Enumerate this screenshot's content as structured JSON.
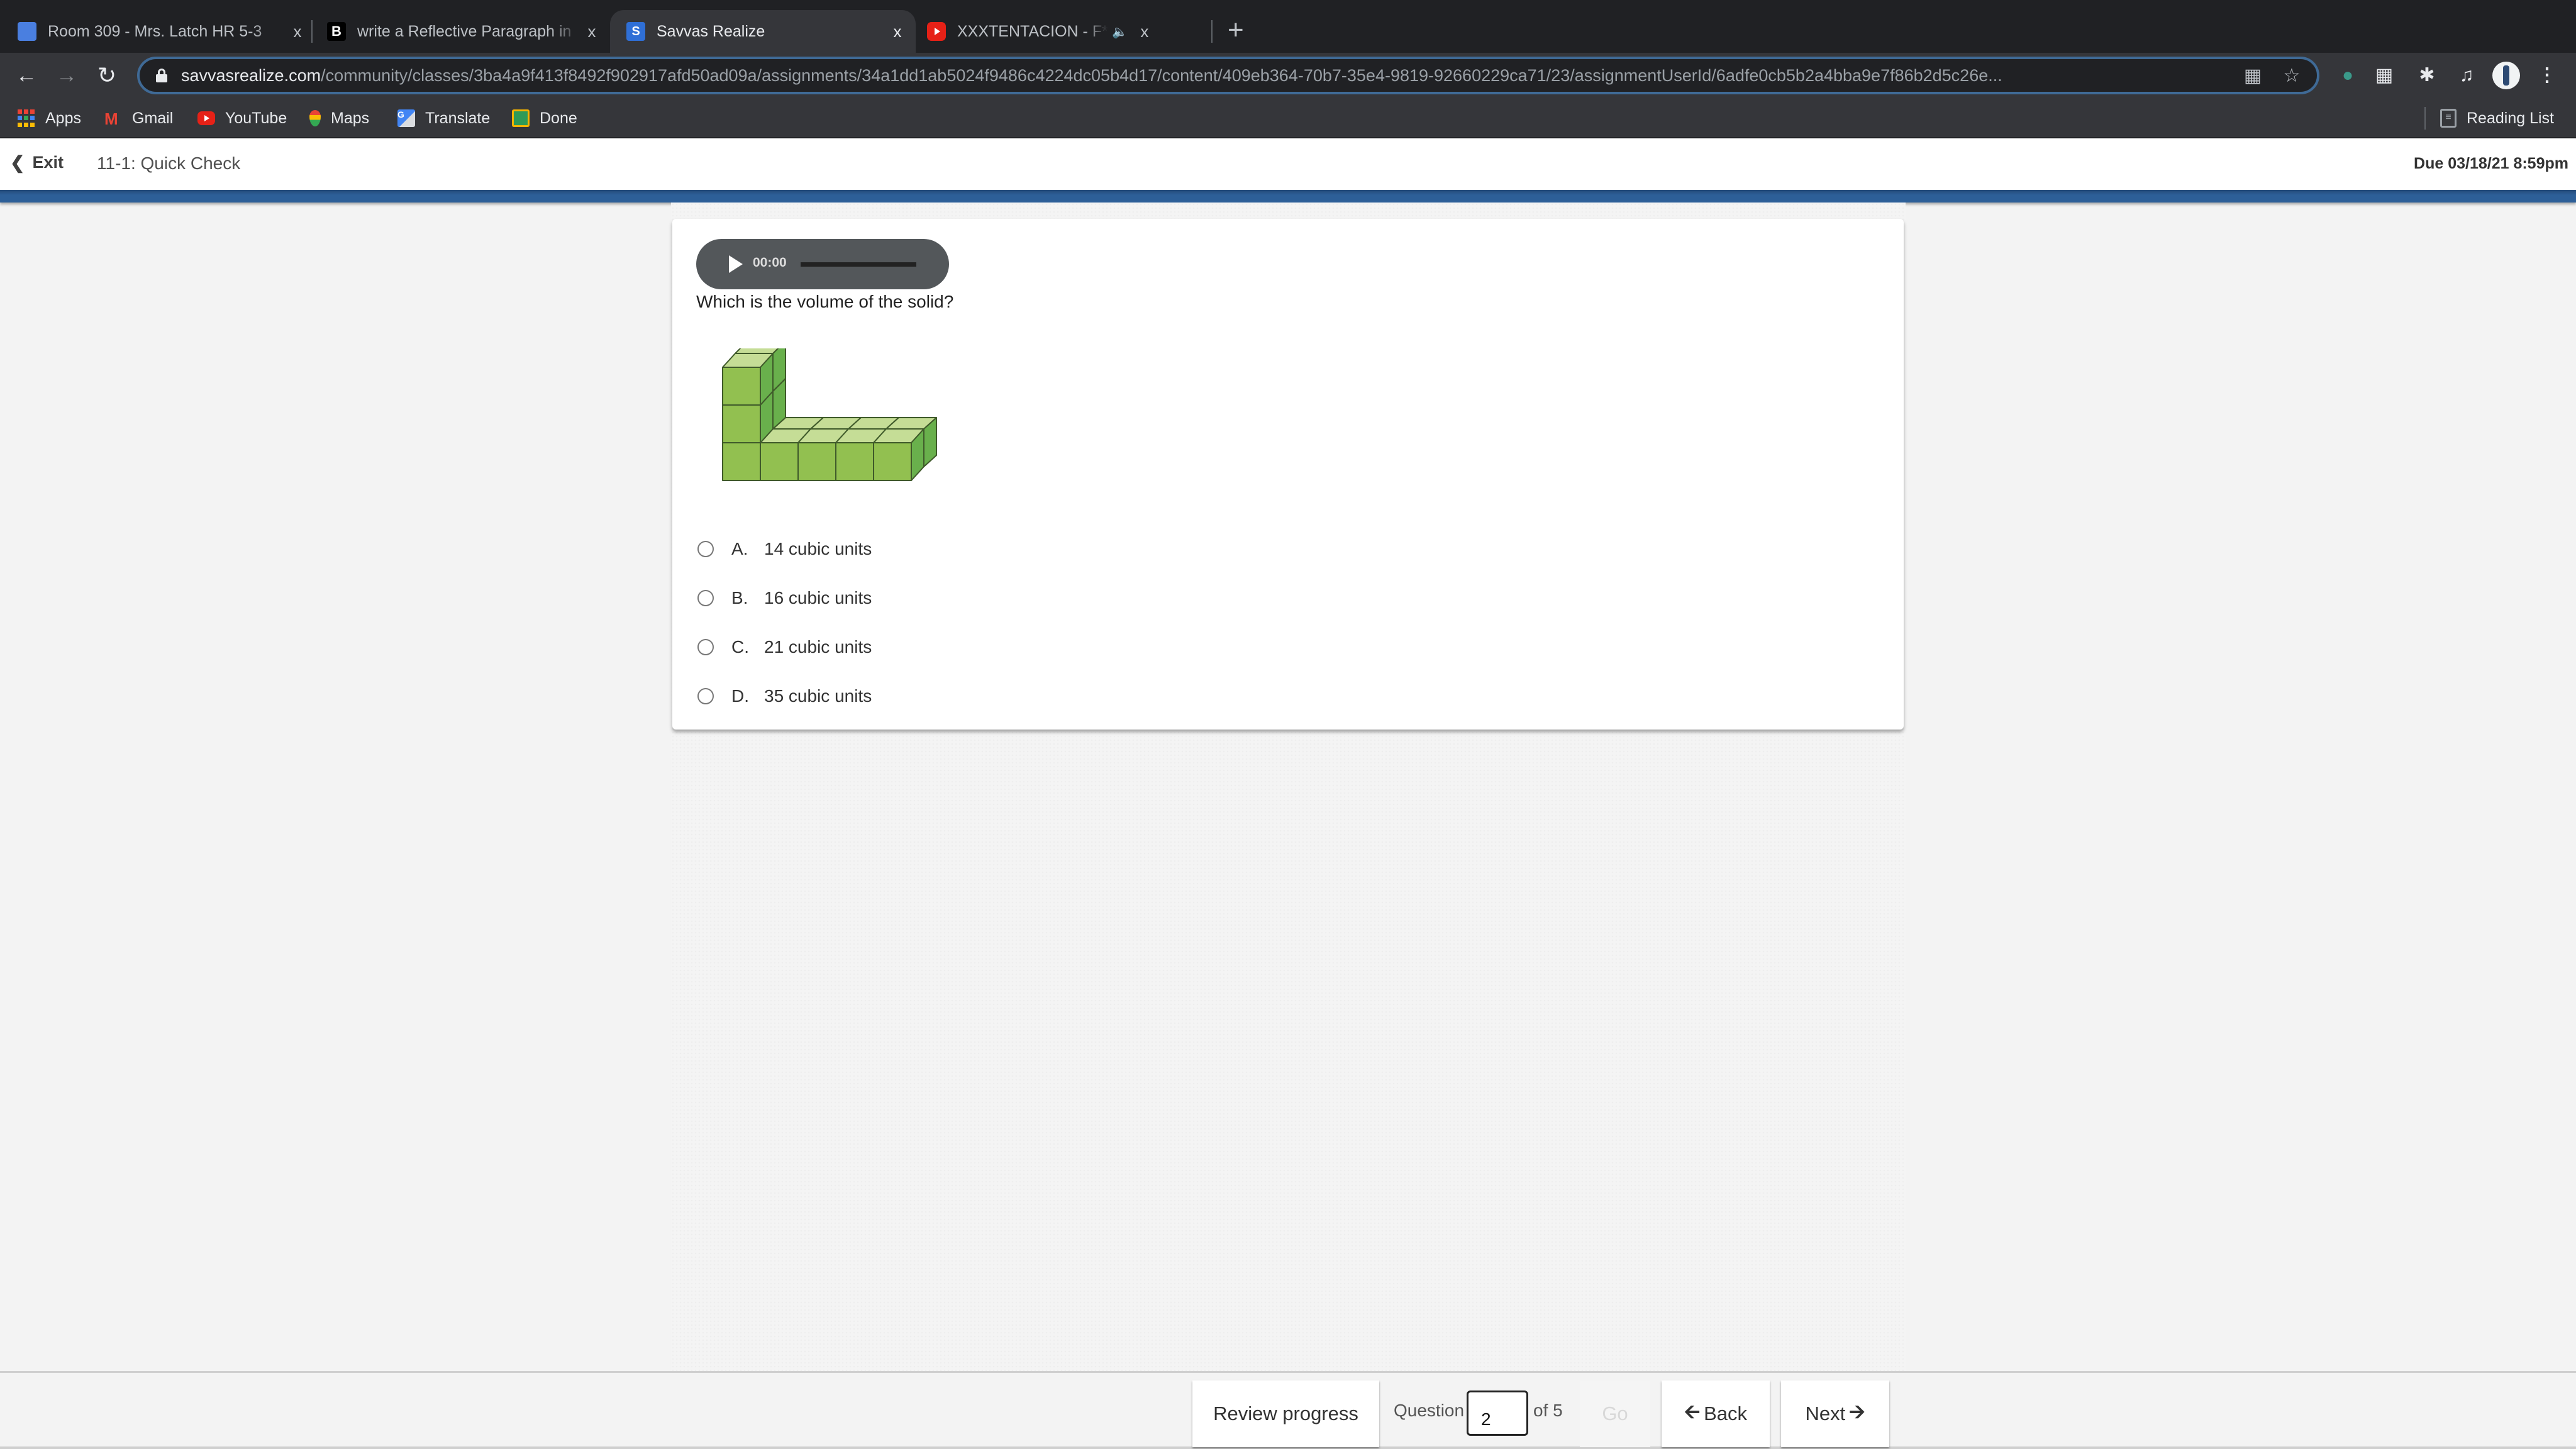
{
  "browser": {
    "tabs": [
      {
        "title": "Room 309 - Mrs. Latch HR 5-3",
        "icon": "google-classroom-icon",
        "active": false
      },
      {
        "title": "write a Reflective Paragraph in",
        "icon": "brainly-icon",
        "active": false
      },
      {
        "title": "Savvas Realize",
        "icon": "savvas-icon",
        "active": true
      },
      {
        "title": "XXXTENTACION - F*ck Love",
        "icon": "youtube-icon",
        "active": false,
        "playing_audio": true
      }
    ],
    "new_tab_label": "+",
    "close_label": "x",
    "url_host": "savvasrealize.com",
    "url_path": "/community/classes/3ba4a9f413f8492f902917afd50ad09a/assignments/34a1dd1ab5024f9486c4224dc05b4d17/content/409eb364-70b7-35e4-9819-92660229ca71/23/assignmentUserId/6adfe0cb5b2a4bba9e7f86b2d5c26e...",
    "bookmarks": [
      {
        "label": "Apps",
        "icon": "apps-grid-icon"
      },
      {
        "label": "Gmail",
        "icon": "gmail-icon"
      },
      {
        "label": "YouTube",
        "icon": "youtube-icon"
      },
      {
        "label": "Maps",
        "icon": "maps-pin-icon"
      },
      {
        "label": "Translate",
        "icon": "translate-icon"
      },
      {
        "label": "Done",
        "icon": "google-classroom-icon"
      }
    ],
    "reading_list_label": "Reading List"
  },
  "app": {
    "exit_label": "Exit",
    "quiz_title": "11-1: Quick Check",
    "due_text": "Due 03/18/21 8:59pm",
    "brand_color": "#2d5f98"
  },
  "question": {
    "audio_time": "00:00",
    "audio_progress": 0,
    "prompt": "Which is the volume of the solid?",
    "figure": {
      "description": "L-shaped solid built from unit cubes: a 5x2 base layer with a 2x1 vertical column 3 cubes tall at the left end",
      "cube_color": "#8fc04f"
    },
    "options": [
      {
        "letter": "A.",
        "text": "14 cubic units",
        "selected": false
      },
      {
        "letter": "B.",
        "text": "16 cubic units",
        "selected": false
      },
      {
        "letter": "C.",
        "text": "21 cubic units",
        "selected": false
      },
      {
        "letter": "D.",
        "text": "35 cubic units",
        "selected": false
      }
    ]
  },
  "footer": {
    "review_label": "Review progress",
    "question_label": "Question",
    "question_number": "2",
    "of_label": "of 5",
    "go_label": "Go",
    "back_label": "Back",
    "next_label": "Next"
  }
}
